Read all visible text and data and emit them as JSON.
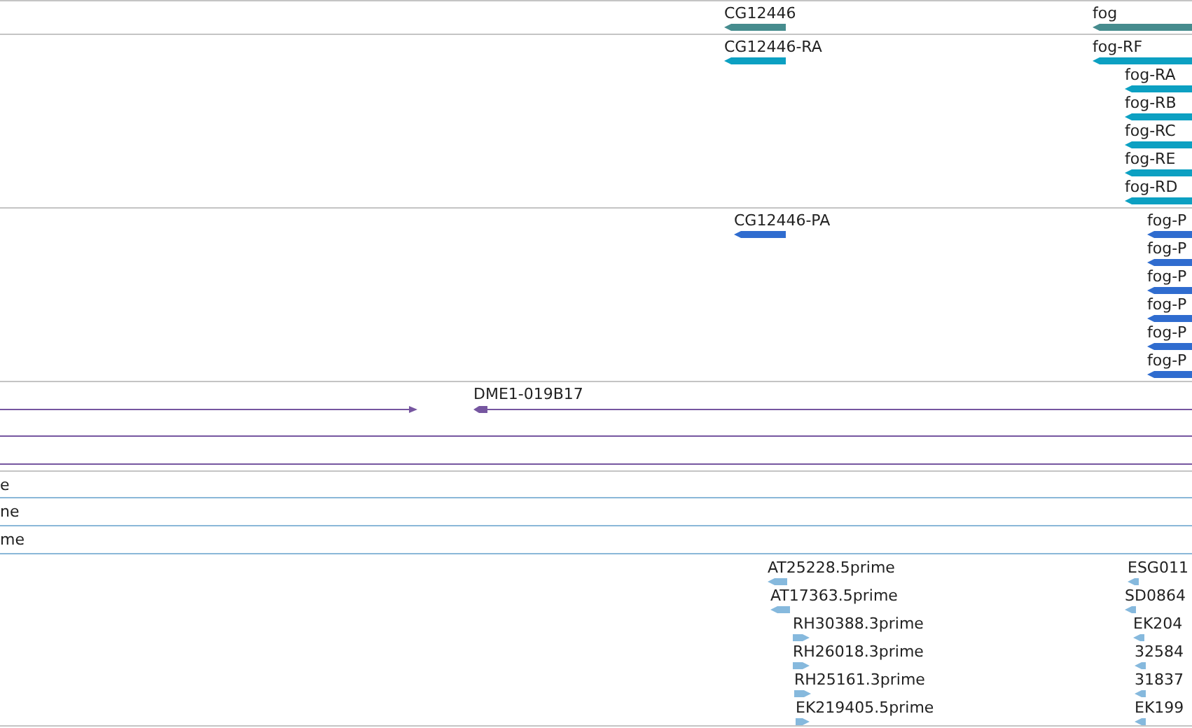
{
  "tracks": [
    {
      "kind": "gene",
      "features": [
        {
          "label": "CG12446",
          "reverse": true
        },
        {
          "label": "fog",
          "reverse": true
        }
      ]
    },
    {
      "kind": "transcript",
      "features": [
        {
          "label": "CG12446-RA",
          "reverse": true
        },
        {
          "label": "fog-RF",
          "reverse": true
        },
        {
          "label": "fog-RA",
          "reverse": true
        },
        {
          "label": "fog-RB",
          "reverse": true
        },
        {
          "label": "fog-RC",
          "reverse": true
        },
        {
          "label": "fog-RE",
          "reverse": true
        },
        {
          "label": "fog-RD",
          "reverse": true
        }
      ]
    },
    {
      "kind": "protein",
      "features": [
        {
          "label": "CG12446-PA",
          "reverse": true
        },
        {
          "label": "fog-P",
          "reverse": true
        },
        {
          "label": "fog-P",
          "reverse": true
        },
        {
          "label": "fog-P",
          "reverse": true
        },
        {
          "label": "fog-P",
          "reverse": true
        },
        {
          "label": "fog-P",
          "reverse": true
        },
        {
          "label": "fog-P",
          "reverse": true
        }
      ]
    },
    {
      "kind": "clone",
      "features": [
        {
          "reverse": false
        },
        {
          "label": "DME1-019B17",
          "reverse": true
        }
      ]
    },
    {
      "kind": "stub",
      "label": "e"
    },
    {
      "kind": "stub",
      "label": "ne"
    },
    {
      "kind": "stub",
      "label": "me"
    },
    {
      "kind": "est",
      "features": [
        {
          "label": "AT25228.5prime",
          "reverse": true
        },
        {
          "label": "AT17363.5prime",
          "reverse": true
        },
        {
          "label": "RH30388.3prime",
          "reverse": false
        },
        {
          "label": "RH26018.3prime",
          "reverse": false
        },
        {
          "label": "RH25161.3prime",
          "reverse": false
        },
        {
          "label": "EK219405.5prime",
          "reverse": false
        },
        {
          "label": "ESG011",
          "reverse": true
        },
        {
          "label": "SD0864",
          "reverse": true
        },
        {
          "label": "EK204",
          "reverse": true
        },
        {
          "label": "32584",
          "reverse": true
        },
        {
          "label": "31837",
          "reverse": true
        },
        {
          "label": "EK199",
          "reverse": true
        }
      ]
    }
  ]
}
